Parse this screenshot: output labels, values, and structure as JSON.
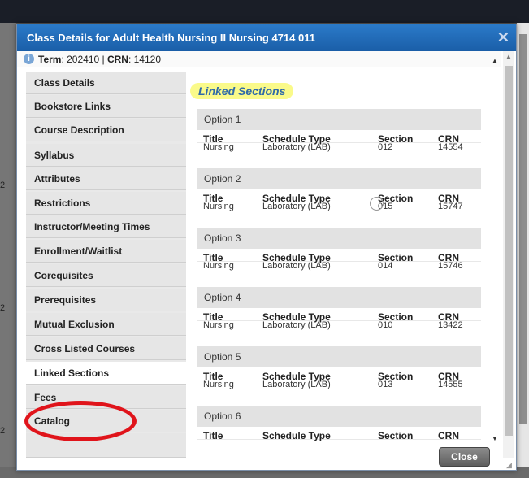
{
  "dialog": {
    "title": "Class Details for Adult Health Nursing II Nursing 4714 011",
    "close_glyph": "✕",
    "term_label": "Term",
    "term_value": ": 202410 | ",
    "crn_label": "CRN",
    "crn_value": ": 14120",
    "close_button": "Close"
  },
  "sidebar": {
    "items": [
      {
        "label": "Class Details"
      },
      {
        "label": "Bookstore Links"
      },
      {
        "label": "Course Description"
      },
      {
        "label": "Syllabus"
      },
      {
        "label": "Attributes"
      },
      {
        "label": "Restrictions"
      },
      {
        "label": "Instructor/Meeting Times"
      },
      {
        "label": "Enrollment/Waitlist"
      },
      {
        "label": "Corequisites"
      },
      {
        "label": "Prerequisites"
      },
      {
        "label": "Mutual Exclusion"
      },
      {
        "label": "Cross Listed Courses"
      },
      {
        "label": "Linked Sections"
      },
      {
        "label": "Fees"
      },
      {
        "label": "Catalog"
      }
    ],
    "active": "Linked Sections"
  },
  "content": {
    "heading": "Linked Sections",
    "columns": [
      "Title",
      "Schedule Type",
      "Section",
      "CRN"
    ],
    "options": [
      {
        "label": "Option 1",
        "title": "Nursing",
        "schedule_type": "Laboratory (LAB)",
        "section": "012",
        "crn": "14554"
      },
      {
        "label": "Option 2",
        "title": "Nursing",
        "schedule_type": "Laboratory (LAB)",
        "section": "015",
        "crn": "15747"
      },
      {
        "label": "Option 3",
        "title": "Nursing",
        "schedule_type": "Laboratory (LAB)",
        "section": "014",
        "crn": "15746"
      },
      {
        "label": "Option 4",
        "title": "Nursing",
        "schedule_type": "Laboratory (LAB)",
        "section": "010",
        "crn": "13422"
      },
      {
        "label": "Option 5",
        "title": "Nursing",
        "schedule_type": "Laboratory (LAB)",
        "section": "013",
        "crn": "14555"
      },
      {
        "label": "Option 6",
        "title": "",
        "schedule_type": "",
        "section": "",
        "crn": ""
      }
    ]
  },
  "background": {
    "edge_digit": "2"
  }
}
